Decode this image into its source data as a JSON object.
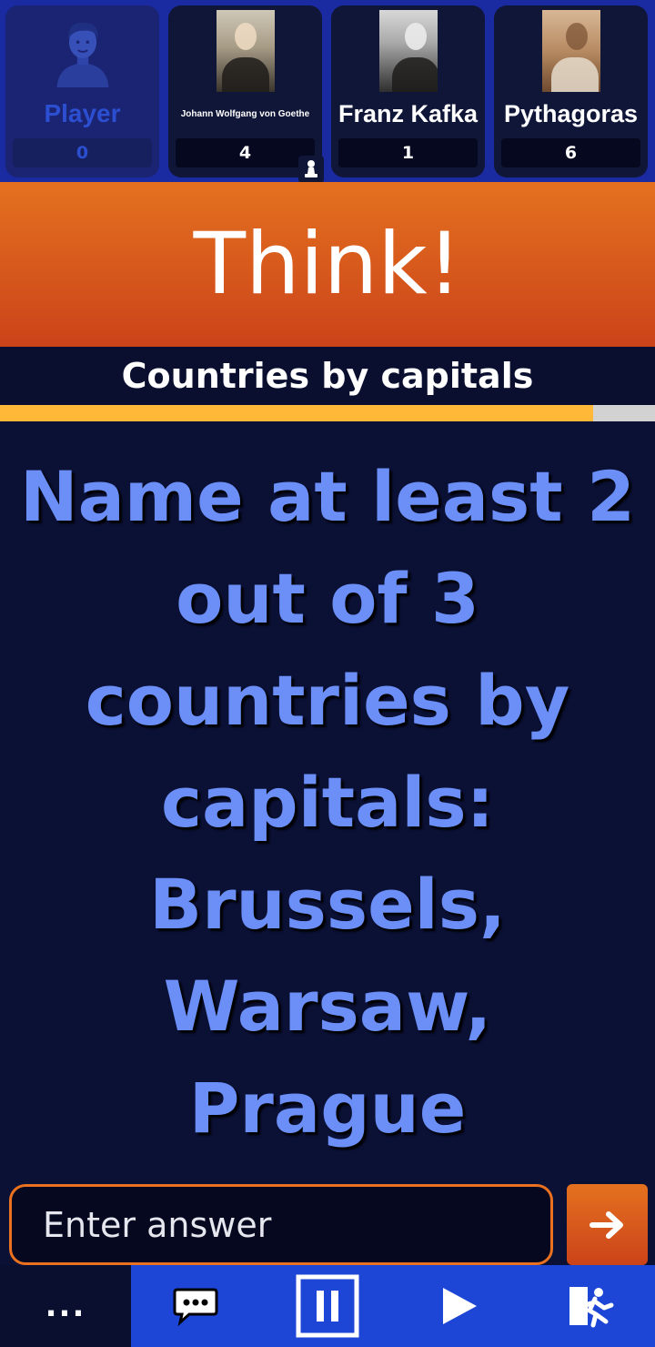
{
  "players": [
    {
      "name": "Player",
      "score": "0",
      "avatar": "person-avatar-icon",
      "is_self": true
    },
    {
      "name": "Johann Wolfgang von Goethe",
      "score": "4",
      "avatar": "goethe-portrait",
      "turn_icon": "pawn-icon"
    },
    {
      "name": "Franz Kafka",
      "score": "1",
      "avatar": "kafka-portrait"
    },
    {
      "name": "Pythagoras",
      "score": "6",
      "avatar": "pythagoras-portrait"
    }
  ],
  "banner": {
    "text": "Think!"
  },
  "category": {
    "title": "Countries by capitals"
  },
  "timer": {
    "remaining_fraction": 0.905
  },
  "question": {
    "text": "Name at least 2 out of 3 countries by capitals: Brussels, Warsaw, Prague"
  },
  "answer": {
    "placeholder": "Enter answer",
    "value": ""
  },
  "toolbar": {
    "more_label": "...",
    "icons": [
      "chat-icon",
      "pause-icon",
      "play-icon",
      "exit-icon"
    ]
  },
  "colors": {
    "accent_orange": "#e4711f",
    "question_blue": "#6b8ff7",
    "timer_yellow": "#ffb838",
    "toolbar_blue": "#1d46d6",
    "background_navy": "#0b1035"
  }
}
